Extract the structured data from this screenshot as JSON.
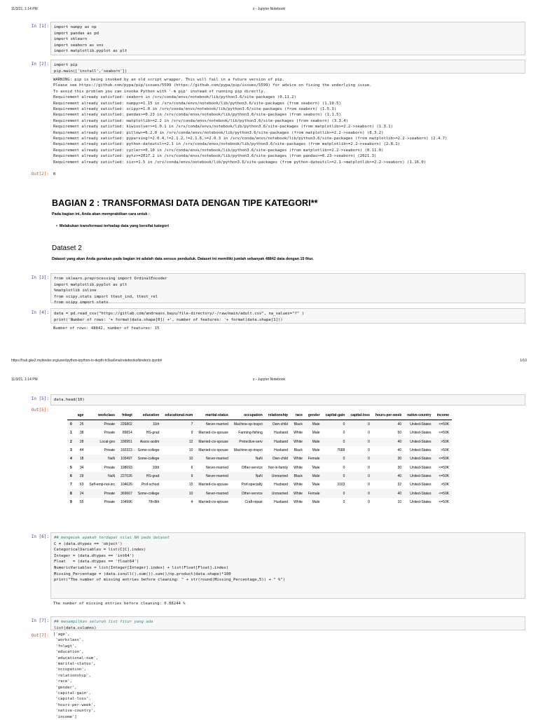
{
  "page1": {
    "timestamp": "11/3/21, 1:14 PM",
    "title": "z - Jupyter Notebook",
    "footer_url": "https://hub.gke2.mybinder.org/user/ipython-ipython-in-depth-tc0ua6ma/notebooks/binder/z.ipynb#",
    "page_number": "1/10"
  },
  "page2": {
    "timestamp": "11/3/21, 1:14 PM",
    "title": "z - Jupyter Notebook"
  },
  "cells": {
    "c1": {
      "prompt": "In [1]:",
      "code": [
        "import numpy as np",
        "import pandas as pd",
        "import sklearn",
        "import seaborn as sns",
        "import matplotlib.pyplot as plt"
      ]
    },
    "c2": {
      "prompt": "In [2]:",
      "code": [
        "import pip",
        "pip.main(['install','seaborn'])"
      ],
      "output": [
        "WARNING: pip is being invoked by an old script wrapper. This will fail in a future version of pip.",
        "Please see https://github.com/pypa/pip/issues/5599 (https://github.com/pypa/pip/issues/5599) for advice on fixing the underlying issue.",
        "To avoid this problem you can invoke Python with '-m pip' instead of running pip directly.",
        "",
        "Requirement already satisfied: seaborn in /srv/conda/envs/notebook/lib/python3.6/site-packages (0.11.2)",
        "Requirement already satisfied: numpy>=1.15 in /srv/conda/envs/notebook/lib/python3.6/site-packages (from seaborn) (1.19.5)",
        "Requirement already satisfied: scipy>=1.0 in /srv/conda/envs/notebook/lib/python3.6/site-packages (from seaborn) (1.5.3)",
        "Requirement already satisfied: pandas>=0.23 in /srv/conda/envs/notebook/lib/python3.6/site-packages (from seaborn) (1.1.5)",
        "Requirement already satisfied: matplotlib>=2.2 in /srv/conda/envs/notebook/lib/python3.6/site-packages (from seaborn) (3.3.4)",
        "Requirement already satisfied: kiwisolver>=1.0.1 in /srv/conda/envs/notebook/lib/python3.6/site-packages (from matplotlib>=2.2->seaborn) (1.3.1)",
        "Requirement already satisfied: pillow>=6.2.0 in /srv/conda/envs/notebook/lib/python3.6/site-packages (from matplotlib>=2.2->seaborn) (8.3.2)",
        "Requirement already satisfied: pyparsing!=2.0.4,!=2.1.2,!=2.1.6,>=2.0.3 in /srv/conda/envs/notebook/lib/python3.6/site-packages (from matplotlib>=2.2->seaborn) (2.4.7)",
        "Requirement already satisfied: python-dateutil>=2.1 in /srv/conda/envs/notebook/lib/python3.6/site-packages (from matplotlib>=2.2->seaborn) (2.8.2)",
        "Requirement already satisfied: cycler>=0.10 in /srv/conda/envs/notebook/lib/python3.6/site-packages (from matplotlib>=2.2->seaborn) (0.11.0)",
        "Requirement already satisfied: pytz>=2017.2 in /srv/conda/envs/notebook/lib/python3.6/site-packages (from pandas>=0.23->seaborn) (2021.3)",
        "Requirement already satisfied: six>=1.5 in /srv/conda/envs/notebook/lib/python3.6/site-packages (from python-dateutil>=2.1->matplotlib>=2.2->seaborn) (1.16.0)"
      ],
      "out_prompt": "Out[2]:",
      "out_value": "0"
    },
    "md": {
      "heading": "BAGIAN 2 : TRANSFORMASI DATA DENGAN TIPE KATEGORI**",
      "intro": "Pada bagian ini, Anda akan mempraktikan cara untuk :",
      "bullet": "Melakukan transformasi terhadap data yang bersifat kategori",
      "subheading": "Dataset 2",
      "description": "Dataset yang akan Anda gunakan pada bagian ini adalah data sensus penduduk. Dataset ini memiliki jumlah sebanyak 48842 data dengan 15 fitur."
    },
    "c3": {
      "prompt": "In [3]:",
      "code": [
        "from sklearn.preprocessing import OrdinalEncoder",
        "import matplotlib.pyplot as plt",
        "%matplotlib inline",
        "from scipy.stats import ttest_ind, ttest_rel",
        "from scipy import stats"
      ]
    },
    "c4": {
      "prompt": "In [4]:",
      "code": [
        "data = pd.read_csv(\"https://gitlab.com/andreass.bayu/file-directory/-/raw/main/adult.csv\", na_values=\"?\" )",
        "print('Number of rows: '+ format(data.shape[0]) +', number of features: '+ format(data.shape[1]))"
      ],
      "output": [
        "Number of rows: 48842, number of features: 15"
      ]
    },
    "c5": {
      "prompt": "In [5]:",
      "code": [
        "data.head(10)"
      ],
      "out_prompt": "Out[5]:"
    },
    "c6": {
      "prompt": "In [6]:",
      "code": [
        "## mengecek apakah terdapat nilai NA pada dataset",
        "",
        "C = (data.dtypes == 'object')",
        "CategoricalVariables = list(C[C].index)",
        "",
        "Integer = (data.dtypes == 'int64')",
        "Float   = (data.dtypes == 'float64')",
        "NumericVariables = list(Integer[Integer].index) + list(Float[Float].index)",
        "",
        "Missing_Percentage = (data.isnull().sum()).sum()/np.product(data.shape)*100",
        "print(\"The number of missing entries before cleaning: \" + str(round(Missing_Percentage,5)) + \" %\")"
      ],
      "output": [
        "The number of missing entries before cleaning: 0.88244 %"
      ]
    },
    "c7": {
      "prompt": "In [7]:",
      "code": [
        "## menampilkan seluruh list fitur yang ada",
        "list(data.columns)"
      ],
      "out_prompt": "Out[7]:",
      "output": [
        "['age',",
        " 'workclass',",
        " 'fnlwgt',",
        " 'education',",
        " 'educational-num',",
        " 'marital-status',",
        " 'occupation',",
        " 'relationship',",
        " 'race',",
        " 'gender',",
        " 'capital-gain',",
        " 'capital-loss',",
        " 'hours-per-week',",
        " 'native-country',",
        " 'income']"
      ]
    }
  },
  "table": {
    "columns": [
      "",
      "age",
      "workclass",
      "fnlwgt",
      "education",
      "educational-num",
      "marital-status",
      "occupation",
      "relationship",
      "race",
      "gender",
      "capital-gain",
      "capital-loss",
      "hours-per-week",
      "native-country",
      "income"
    ],
    "rows": [
      [
        "0",
        "25",
        "Private",
        "226802",
        "11th",
        "7",
        "Never-married",
        "Machine-op-inspct",
        "Own-child",
        "Black",
        "Male",
        "0",
        "0",
        "40",
        "United-States",
        "<=50K"
      ],
      [
        "1",
        "38",
        "Private",
        "89814",
        "HS-grad",
        "9",
        "Married-civ-spouse",
        "Farming-fishing",
        "Husband",
        "White",
        "Male",
        "0",
        "0",
        "50",
        "United-States",
        "<=50K"
      ],
      [
        "2",
        "28",
        "Local-gov",
        "336951",
        "Assoc-acdm",
        "12",
        "Married-civ-spouse",
        "Protective-serv",
        "Husband",
        "White",
        "Male",
        "0",
        "0",
        "40",
        "United-States",
        ">50K"
      ],
      [
        "3",
        "44",
        "Private",
        "160323",
        "Some-college",
        "10",
        "Married-civ-spouse",
        "Machine-op-inspct",
        "Husband",
        "Black",
        "Male",
        "7688",
        "0",
        "40",
        "United-States",
        ">50K"
      ],
      [
        "4",
        "18",
        "NaN",
        "103497",
        "Some-college",
        "10",
        "Never-married",
        "NaN",
        "Own-child",
        "White",
        "Female",
        "0",
        "0",
        "30",
        "United-States",
        "<=50K"
      ],
      [
        "5",
        "34",
        "Private",
        "198693",
        "10th",
        "6",
        "Never-married",
        "Other-service",
        "Not-in-family",
        "White",
        "Male",
        "0",
        "0",
        "30",
        "United-States",
        "<=50K"
      ],
      [
        "6",
        "29",
        "NaN",
        "227026",
        "HS-grad",
        "9",
        "Never-married",
        "NaN",
        "Unmarried",
        "Black",
        "Male",
        "0",
        "0",
        "40",
        "United-States",
        "<=50K"
      ],
      [
        "7",
        "63",
        "Self-emp-not-inc",
        "104626",
        "Prof-school",
        "15",
        "Married-civ-spouse",
        "Prof-specialty",
        "Husband",
        "White",
        "Male",
        "3103",
        "0",
        "32",
        "United-States",
        ">50K"
      ],
      [
        "8",
        "24",
        "Private",
        "369667",
        "Some-college",
        "10",
        "Never-married",
        "Other-service",
        "Unmarried",
        "White",
        "Female",
        "0",
        "0",
        "40",
        "United-States",
        "<=50K"
      ],
      [
        "9",
        "55",
        "Private",
        "104996",
        "7th-8th",
        "4",
        "Married-civ-spouse",
        "Craft-repair",
        "Husband",
        "White",
        "Male",
        "0",
        "0",
        "10",
        "United-States",
        "<=50K"
      ]
    ]
  }
}
